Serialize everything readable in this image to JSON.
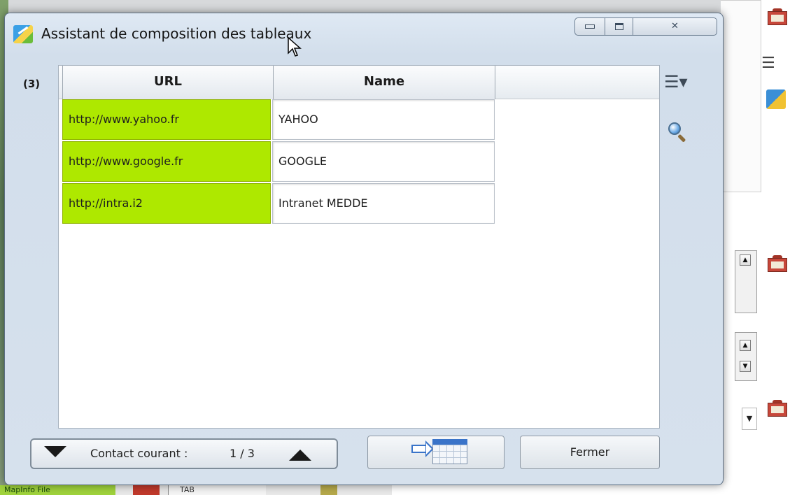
{
  "window": {
    "title": "Assistant de composition des tableaux",
    "controls": {
      "close_glyph": "✕"
    }
  },
  "table": {
    "count_label": "(3)",
    "columns": [
      "URL",
      "Name"
    ],
    "rows": [
      {
        "url": "http://www.yahoo.fr",
        "name": "YAHOO"
      },
      {
        "url": "http://www.google.fr",
        "name": "GOOGLE"
      },
      {
        "url": "http://intra.i2",
        "name": "Intranet MEDDE"
      }
    ],
    "url_cell_color": "#aee800"
  },
  "navigation": {
    "label": "Contact courant :",
    "position": "1 / 3"
  },
  "buttons": {
    "export_icon": "export-to-table-icon",
    "close_label": "Fermer"
  },
  "side_icons": [
    "list-options-icon",
    "search-icon"
  ],
  "background": {
    "taskbar_item_1": "MapInfo File",
    "taskbar_item_2": "TAB"
  }
}
